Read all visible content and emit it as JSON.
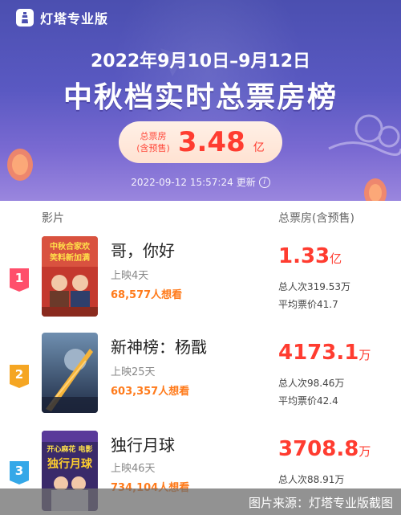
{
  "header": {
    "brand": "灯塔专业版",
    "date_range": "2022年9月10日–9月12日",
    "title": "中秋档实时总票房榜",
    "total_label_line1": "总票房",
    "total_label_line2": "(含预售)",
    "total_value": "3.48",
    "total_unit": "亿",
    "updated_time": "2022-09-12 15:57:24",
    "updated_suffix": "更新",
    "info_glyph": "i"
  },
  "list_header": {
    "film": "影片",
    "gross": "总票房(含预售)"
  },
  "films": [
    {
      "rank": "1",
      "rank_color": "#ff4f6b",
      "title": "哥，你好",
      "days": "上映4天",
      "want": "68,577人想看",
      "gross_value": "1.33",
      "gross_unit": "亿",
      "admissions": "总人次319.53万",
      "avg_price": "平均票价41.7",
      "poster_color": "#c4392e",
      "poster_text": "中秋合家欢\n笑料新加满"
    },
    {
      "rank": "2",
      "rank_color": "#f5a623",
      "title": "新神榜：杨戬",
      "days": "上映25天",
      "want": "603,357人想看",
      "gross_value": "4173.1",
      "gross_unit": "万",
      "admissions": "总人次98.46万",
      "avg_price": "平均票价42.4",
      "poster_color": "#2f4a6b",
      "poster_text": ""
    },
    {
      "rank": "3",
      "rank_color": "#35a8e8",
      "title": "独行月球",
      "days": "上映46天",
      "want": "734,104人想看",
      "gross_value": "3708.8",
      "gross_unit": "万",
      "admissions": "总人次88.91万",
      "avg_price": "",
      "poster_color": "#3a2a6a",
      "poster_text": "开心麻花 电影\n独行月球"
    }
  ],
  "watermark": "图片来源：灯塔专业版截图",
  "colors": {
    "hero_top": "#4b4fb0",
    "accent_red": "#ff3c30",
    "want_orange": "#ff7a1a"
  }
}
